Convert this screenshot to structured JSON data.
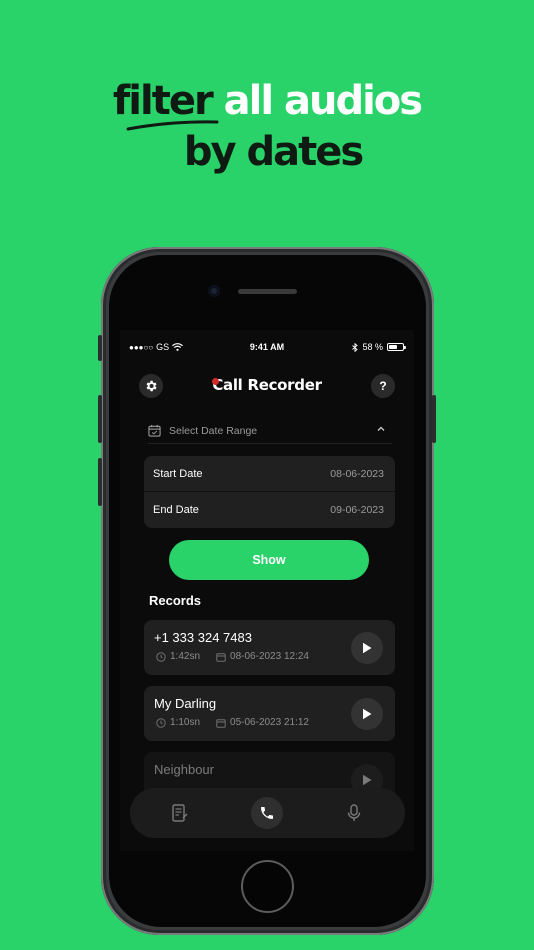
{
  "headline": {
    "line1_highlight": "filter",
    "line1_rest": "all audios",
    "line2": "by dates"
  },
  "status_bar": {
    "carrier": "GS",
    "time": "9:41 AM",
    "battery_percent": "58 %",
    "battery_level": 0.58
  },
  "header": {
    "settings_icon": "gear-icon",
    "title": "Call Recorder",
    "help_label": "?"
  },
  "filter": {
    "select_label": "Select Date Range",
    "start_label": "Start Date",
    "start_value": "08-06-2023",
    "end_label": "End Date",
    "end_value": "09-06-2023",
    "show_button": "Show"
  },
  "records": {
    "title": "Records",
    "items": [
      {
        "name": "+1 333 324 7483",
        "duration": "1:42sn",
        "datetime": "08-06-2023 12:24"
      },
      {
        "name": "My Darling",
        "duration": "1:10sn",
        "datetime": "05-06-2023 21:12"
      },
      {
        "name": "Neighbour",
        "duration": "",
        "datetime": ""
      }
    ]
  },
  "bottom_nav": {
    "items": [
      {
        "icon": "notes-icon",
        "active": false
      },
      {
        "icon": "phone-icon",
        "active": true
      },
      {
        "icon": "microphone-icon",
        "active": false
      }
    ]
  },
  "colors": {
    "brand_green": "#2ad26a",
    "dark_text": "#0f1a13",
    "card_bg": "#202020",
    "screen_bg": "#0b0b0b"
  }
}
